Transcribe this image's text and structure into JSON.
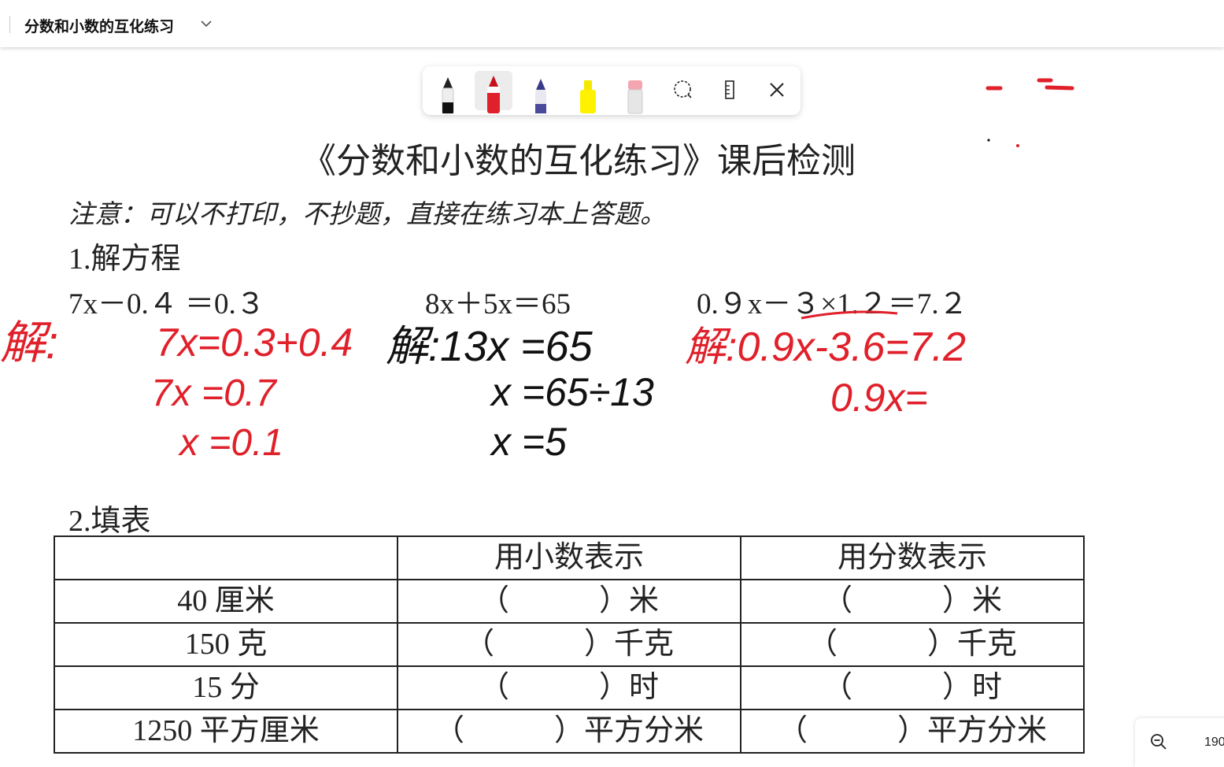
{
  "app": {
    "doc_title": "分数和小数的互化练习"
  },
  "toolbar": {
    "tools": [
      {
        "name": "black-pen",
        "color": "#111111"
      },
      {
        "name": "red-pen",
        "color": "#e0202a",
        "selected": true
      },
      {
        "name": "galaxy-pen",
        "color": "#3a3a8a"
      },
      {
        "name": "highlighter",
        "color": "#ffee22"
      },
      {
        "name": "eraser",
        "color": "#f4a6b0"
      }
    ]
  },
  "document": {
    "title": "《分数和小数的互化练习》课后检测",
    "note": "注意：可以不打印，不抄题，直接在练习本上答题。",
    "q1_label": "1.解方程",
    "equations": [
      "7x－0.４ ＝0.３",
      "8x＋5x＝65",
      "0.９x－３×1.２＝7.２"
    ],
    "q2_label": "2.填表",
    "table": {
      "headers": [
        "",
        "用小数表示",
        "用分数表示"
      ],
      "rows": [
        [
          "40 厘米",
          "（　　　）米",
          "（　　　）米"
        ],
        [
          "150 克",
          "（　　　）千克",
          "（　　　）千克"
        ],
        [
          "15 分",
          "（　　　）时",
          "（　　　）时"
        ],
        [
          "1250 平方厘米",
          "（　　　）平方分米",
          "（　　　）平方分米"
        ]
      ]
    }
  },
  "handwriting": {
    "left_label": "解:",
    "left_lines": [
      "7x=0.3+0.4",
      "7x =0.7",
      "x =0.1"
    ],
    "mid_lines": [
      "解:13x =65",
      "x =65÷13",
      "x =5"
    ],
    "right_lines": [
      "解:0.9x-3.6=7.2",
      "0.9x="
    ]
  },
  "zoom": {
    "value": "190"
  },
  "colors": {
    "ink_red": "#e0202a",
    "ink_black": "#111111"
  }
}
